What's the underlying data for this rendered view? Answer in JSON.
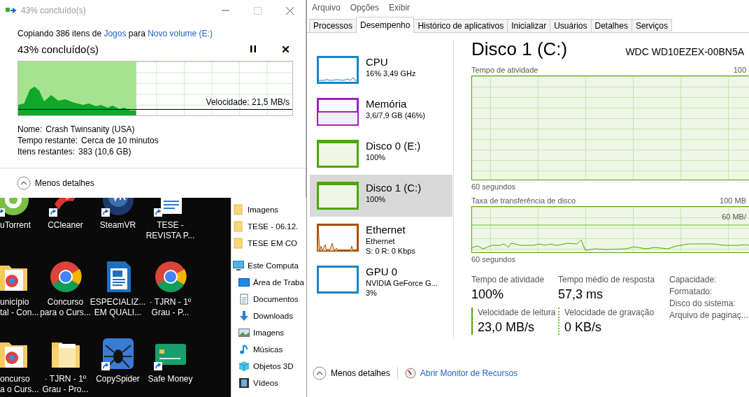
{
  "copy_dialog": {
    "title": "43% concluído(s)",
    "controls": [
      {
        "kind": "minimize",
        "disabled": false
      },
      {
        "kind": "maximize",
        "disabled": true
      },
      {
        "kind": "close",
        "disabled": false
      }
    ],
    "summary": [
      {
        "text": "Copiando 386 itens de",
        "kind": "text"
      },
      {
        "text": "Jogos",
        "kind": "link"
      },
      {
        "text": "para",
        "kind": "text"
      },
      {
        "text": "Novo volume (E:)",
        "kind": "link"
      }
    ],
    "heading": "43% concluído(s)",
    "progress": {
      "level": 0.43,
      "speed": "Velocidade: 21,5 MB/s"
    },
    "details": [
      {
        "label": "Nome:",
        "value": "Crash Twinsanity (USA)"
      },
      {
        "label": "Tempo restante:",
        "value": "Cerca de 10 minutos"
      },
      {
        "label": "Itens restantes:",
        "value": "383 (10,6 GB)"
      }
    ],
    "footer": "Menos detalhes"
  },
  "desktop": {
    "icons": [
      {
        "label": "uTorrent",
        "kind": "torrent",
        "shortcut": true
      },
      {
        "label": "CCleaner",
        "kind": "brush",
        "shortcut": true
      },
      {
        "label": "SteamVR",
        "kind": "vr",
        "shortcut": true
      },
      {
        "label": "TESE -\nREVISTA P...",
        "kind": "document",
        "shortcut": true
      },
      {
        "label": "unicípio\ntal - Con...",
        "kind": "browser-folder",
        "shortcut": false
      },
      {
        "label": "Concurso\npara o Curs...",
        "kind": "browser",
        "shortcut": false
      },
      {
        "label": "ESPECIALIZ...\nEM QUALI...",
        "kind": "writer",
        "shortcut": false
      },
      {
        "label": "· TJRN - 1º\nGrau - P...",
        "kind": "browser",
        "shortcut": false
      },
      {
        "label": "oncurso\na o Curs...",
        "kind": "browser-folder",
        "shortcut": false
      },
      {
        "label": "· TJRN - 1º\nGrau - Pro...",
        "kind": "folder",
        "shortcut": false
      },
      {
        "label": "CopySpider",
        "kind": "spider",
        "shortcut": true
      },
      {
        "label": "Safe Money",
        "kind": "card",
        "shortcut": true
      }
    ]
  },
  "explorer_nav": [
    {
      "label": "Imagens",
      "kind": "folder"
    },
    {
      "label": "TESE - 06.12.",
      "kind": "folder"
    },
    {
      "label": "TESE EM CO",
      "kind": "folder"
    },
    {
      "label": "Este Computa",
      "kind": "computer",
      "children": [
        {
          "label": "Área de Traba",
          "kind": "desktop"
        },
        {
          "label": "Documentos",
          "kind": "documents"
        },
        {
          "label": "Downloads",
          "kind": "downloads"
        },
        {
          "label": "Imagens",
          "kind": "pictures"
        },
        {
          "label": "Músicas",
          "kind": "music"
        },
        {
          "label": "Objetos 3D",
          "kind": "objects"
        },
        {
          "label": "Vídeos",
          "kind": "videos"
        }
      ]
    }
  ],
  "task_manager": {
    "menu": [
      "Arquivo",
      "Opções",
      "Exibir"
    ],
    "tabs": [
      {
        "label": "Processos",
        "selected": false
      },
      {
        "label": "Desempenho",
        "selected": true
      },
      {
        "label": "Histórico de aplicativos",
        "selected": false
      },
      {
        "label": "Inicializar",
        "selected": false
      },
      {
        "label": "Usuários",
        "selected": false
      },
      {
        "label": "Detalhes",
        "selected": false
      },
      {
        "label": "Serviços",
        "selected": false
      }
    ],
    "resources": [
      {
        "name": "CPU",
        "lines": [
          "16% 3,49 GHz"
        ],
        "kind": "cpu",
        "color": "#1c83c8",
        "selected": false
      },
      {
        "name": "Memória",
        "lines": [
          "3,6/7,9 GB (46%)"
        ],
        "kind": "memory",
        "color": "#a020c0",
        "selected": false
      },
      {
        "name": "Disco 0 (E:)",
        "lines": [
          "100%"
        ],
        "kind": "disk",
        "color": "#4ca60c",
        "selected": false
      },
      {
        "name": "Disco 1 (C:)",
        "lines": [
          "100%"
        ],
        "kind": "disk",
        "color": "#4ca60c",
        "selected": true
      },
      {
        "name": "Ethernet",
        "lines": [
          "Ethernet",
          "S: 0 R: 0 Kbps"
        ],
        "kind": "ethernet",
        "color": "#a74f01",
        "selected": false
      },
      {
        "name": "GPU 0",
        "lines": [
          "NVIDIA GeForce G...",
          "3%"
        ],
        "kind": "gpu",
        "color": "#1c83c8",
        "selected": false
      }
    ],
    "detail": {
      "title": "Disco 1 (C:)",
      "model": "WDC WD10EZEX-00BN5A",
      "activity_chart": {
        "label": "Tempo de atividade",
        "max": "100",
        "footer": "60 segundos"
      },
      "transfer_chart": {
        "label": "Taxa de transferência de disco",
        "max": "100 MB",
        "mark": "60 MB/",
        "footer": "60 segundos"
      },
      "stats": [
        {
          "label": "Tempo de atividade",
          "value": "100%",
          "kind": "plain"
        },
        {
          "label": "Tempo médio de resposta",
          "value": "57,3 ms",
          "kind": "plain"
        },
        {
          "label": "Velocidade de leitura",
          "value": "23,0 MB/s",
          "kind": "read"
        },
        {
          "label": "Velocidade de gravação",
          "value": "0 KB/s",
          "kind": "write"
        }
      ],
      "properties": [
        "Capacidade:",
        "Formatado:",
        "Disco do sistema:",
        "Arquivo de paginaç..."
      ]
    },
    "footer": {
      "less": "Menos detalhes",
      "monitor": "Abrir Monitor de Recursos"
    }
  }
}
